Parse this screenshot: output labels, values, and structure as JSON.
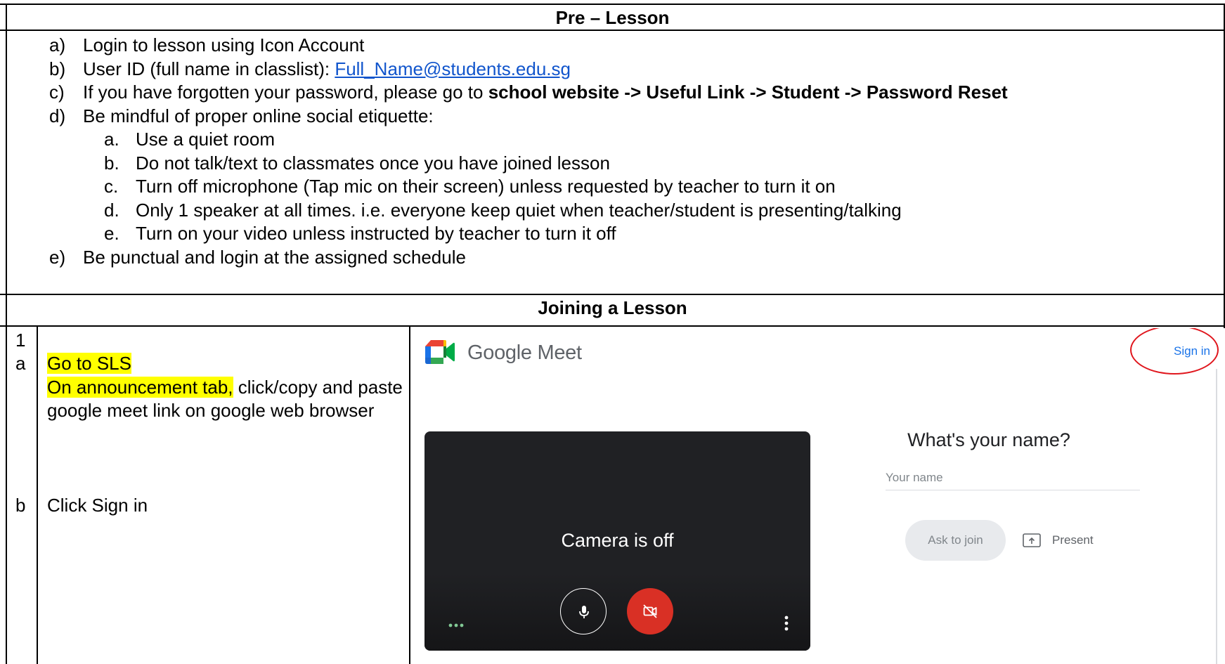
{
  "pre_lesson": {
    "title": "Pre – Lesson",
    "items": [
      {
        "marker": "a)",
        "text": "Login to lesson using Icon Account"
      },
      {
        "marker": "b)",
        "text_prefix": "User ID (full name in classlist): ",
        "link": "Full_Name@students.edu.sg"
      },
      {
        "marker": "c)",
        "text_prefix": "If you have forgotten your password, please go to ",
        "bold": "school website -> Useful Link -> Student -> Password Reset"
      },
      {
        "marker": "d)",
        "text": "Be mindful of proper online social etiquette:"
      },
      {
        "marker": "e)",
        "text": "Be punctual and login at the assigned schedule"
      }
    ],
    "sub_items": [
      {
        "marker": "a.",
        "text": "Use a quiet room"
      },
      {
        "marker": "b.",
        "text": "Do not talk/text to classmates once you have joined lesson"
      },
      {
        "marker": "c.",
        "text": "Turn off microphone (Tap mic on their screen) unless requested by teacher to turn it on"
      },
      {
        "marker": "d.",
        "text": "Only 1 speaker at all times. i.e. everyone keep quiet when teacher/student is presenting/talking"
      },
      {
        "marker": "e.",
        "text": "Turn on your video unless instructed by teacher to turn it off"
      }
    ]
  },
  "joining": {
    "title": "Joining a Lesson",
    "step_number": "1",
    "step_a": {
      "marker": "a",
      "line1": "Go to SLS",
      "line2_highlight": "On announcement tab,",
      "line2_rest": " click/copy and paste google meet link on google web browser"
    },
    "step_b": {
      "marker": "b",
      "text": "Click Sign in"
    }
  },
  "meet": {
    "brand_google": "Google",
    "brand_meet": " Meet",
    "sign_in": "Sign in",
    "camera_status": "Camera is off",
    "name_question": "What's your name?",
    "name_placeholder": "Your name",
    "name_value": "",
    "ask_to_join": "Ask to join",
    "present": "Present"
  },
  "colors": {
    "highlight": "#ffff00",
    "link": "#1155cc",
    "annotation": "#e0161d",
    "meet_blue": "#1a73e8",
    "cam_off_red": "#d93025"
  }
}
